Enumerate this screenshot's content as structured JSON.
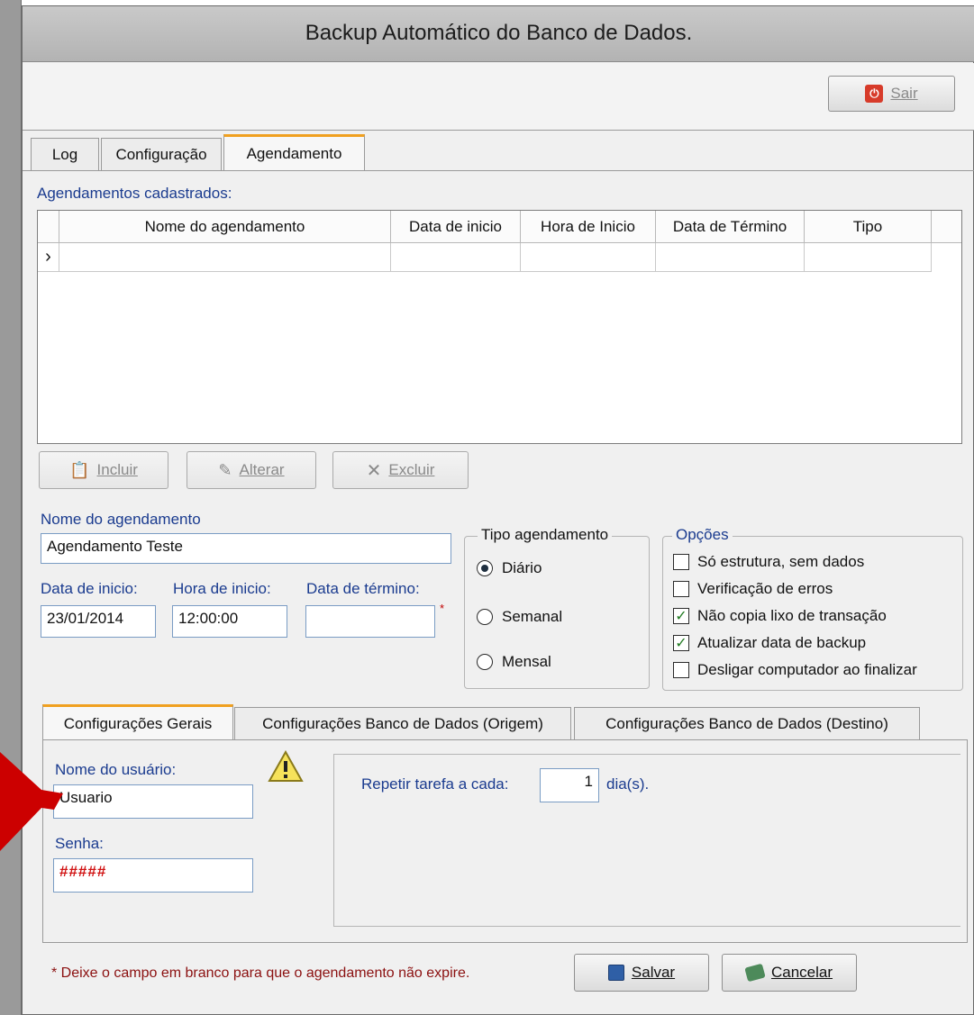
{
  "window": {
    "title": "Backup Automático do Banco de Dados."
  },
  "toolbar": {
    "exit_label": "Sair"
  },
  "tabs": [
    {
      "label": "Log"
    },
    {
      "label": "Configuração"
    },
    {
      "label": "Agendamento"
    }
  ],
  "schedules": {
    "label": "Agendamentos cadastrados:",
    "columns": [
      "Nome do agendamento",
      "Data de inicio",
      "Hora de Inicio",
      "Data de Término",
      "Tipo"
    ],
    "row_indicator": "›"
  },
  "actions": {
    "add": "Incluir",
    "edit": "Alterar",
    "delete": "Excluir"
  },
  "form": {
    "name_label": "Nome do agendamento",
    "name_value": "Agendamento Teste",
    "start_date_label": "Data de inicio:",
    "start_date_value": "23/01/2014",
    "start_time_label": "Hora de inicio:",
    "start_time_value": "12:00:00",
    "end_date_label": "Data de término:",
    "end_date_value": "",
    "required_mark": "*"
  },
  "schedule_type": {
    "title": "Tipo agendamento",
    "options": [
      {
        "label": "Diário",
        "selected": true
      },
      {
        "label": "Semanal",
        "selected": false
      },
      {
        "label": "Mensal",
        "selected": false
      }
    ]
  },
  "options": {
    "title": "Opções",
    "items": [
      {
        "label": "Só estrutura, sem dados",
        "checked": false
      },
      {
        "label": "Verificação de erros",
        "checked": false
      },
      {
        "label": "Não copia lixo de transação",
        "checked": true
      },
      {
        "label": "Atualizar data de backup",
        "checked": true
      },
      {
        "label": "Desligar computador ao finalizar",
        "checked": false
      }
    ]
  },
  "subtabs": [
    {
      "label": "Configurações Gerais"
    },
    {
      "label": "Configurações Banco de Dados (Origem)"
    },
    {
      "label": "Configurações Banco de Dados (Destino)"
    }
  ],
  "general": {
    "user_label": "Nome do usuário:",
    "user_value": "Usuario",
    "password_label": "Senha:",
    "password_value": "#####",
    "repeat_label": "Repetir tarefa a cada:",
    "repeat_value": "1",
    "repeat_unit": "dia(s)."
  },
  "footer": {
    "note": "* Deixe o campo em branco para que o agendamento não expire.",
    "save_label": "Salvar",
    "cancel_label": "Cancelar"
  },
  "colors": {
    "accent_tab": "#f0a020",
    "label_blue": "#1a3b8f",
    "note_red": "#8b1010",
    "arrow_red": "#cc0000"
  }
}
